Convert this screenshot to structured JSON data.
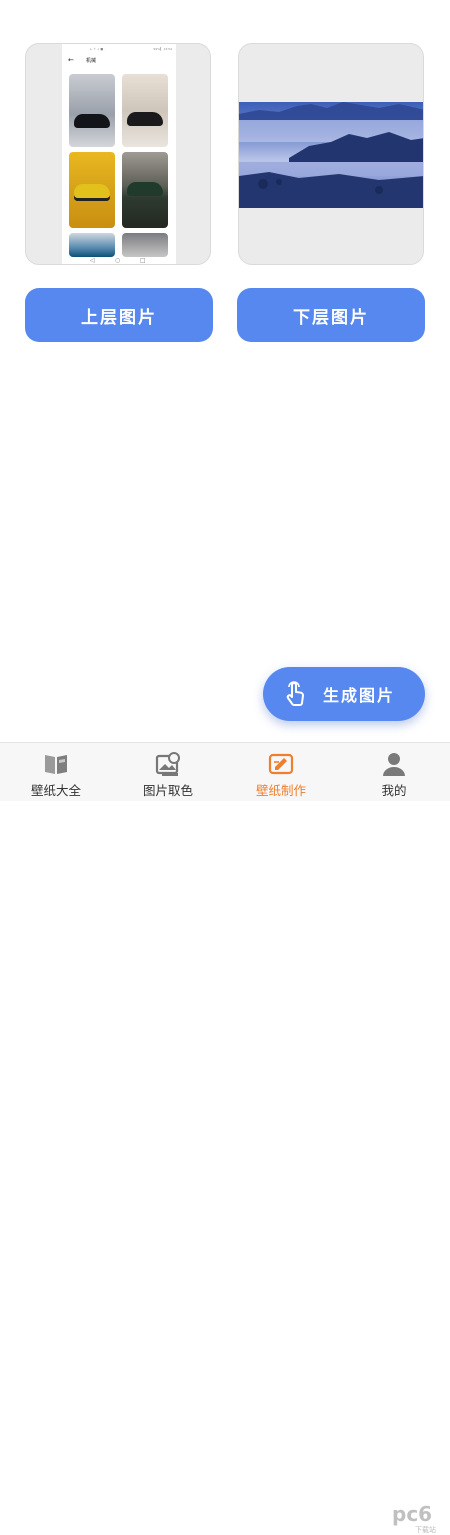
{
  "upper_card": {
    "phone_status_left": "⇤ ↑ ↓ ■ ·",
    "phone_status_right": "99%▎ 13:54",
    "phone_title": "机械",
    "nav_back": "◁",
    "nav_home": "○",
    "nav_recent": "□"
  },
  "buttons": {
    "upper": "上层图片",
    "lower": "下层图片"
  },
  "fab": {
    "label": "生成图片",
    "icon": "tap-hand-icon"
  },
  "bottom_nav": {
    "active_index": 2,
    "items": [
      {
        "label": "壁纸大全",
        "icon": "book-icon"
      },
      {
        "label": "图片取色",
        "icon": "image-palette-icon"
      },
      {
        "label": "壁纸制作",
        "icon": "edit-card-icon"
      },
      {
        "label": "我的",
        "icon": "user-icon"
      }
    ]
  },
  "watermark": {
    "logo": "pc6",
    "text": "下载站"
  },
  "colors": {
    "accent": "#5688ef",
    "active_tab": "#ee7f2d"
  }
}
